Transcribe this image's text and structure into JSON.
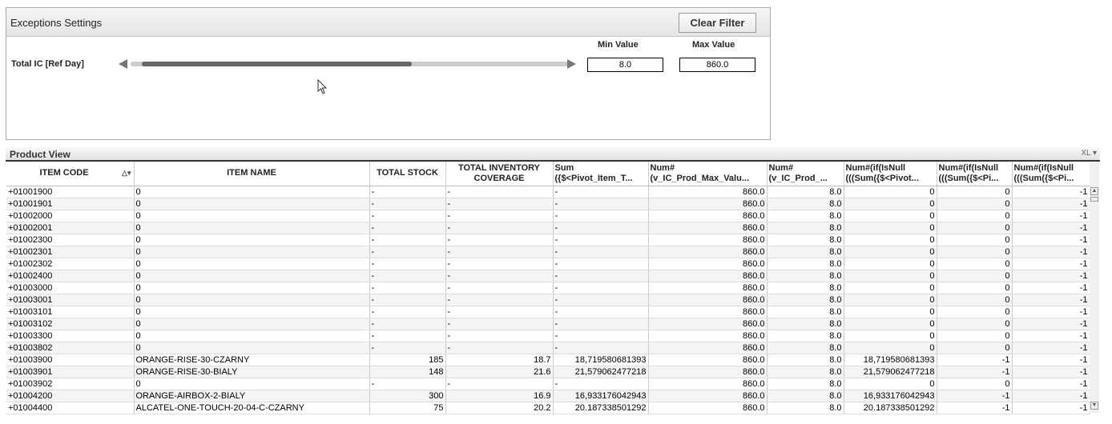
{
  "exceptions": {
    "title": "Exceptions Settings",
    "clear_filter": "Clear Filter",
    "field_label": "Total IC [Ref Day]",
    "min_label": "Min Value",
    "max_label": "Max Value",
    "min_value": "8.0",
    "max_value": "860.0",
    "slider": {
      "range_min": 0,
      "range_max": 1000,
      "low": 8,
      "high": 620
    }
  },
  "product_view": {
    "title": "Product View",
    "icons": "XL ▾",
    "columns": [
      "ITEM CODE",
      "ITEM NAME",
      "TOTAL STOCK",
      "TOTAL INVENTORY COVERAGE",
      "Sum ({$<Pivot_Item_T...",
      "Num# (v_IC_Prod_Max_Valu...",
      "Num# (v_IC_Prod_...",
      "Num#(if(IsNull (((Sum({$<Pivot...",
      "Num#(if(IsNull (((Sum({$<Pi...",
      "Num#(if(IsNull (((Sum({$<Pi..."
    ],
    "rows": [
      [
        "+01001900",
        "0",
        "-",
        "-",
        "-",
        "860.0",
        "8.0",
        "0",
        "0",
        "-1"
      ],
      [
        "+01001901",
        "0",
        "-",
        "-",
        "-",
        "860.0",
        "8.0",
        "0",
        "0",
        "-1"
      ],
      [
        "+01002000",
        "0",
        "-",
        "-",
        "-",
        "860.0",
        "8.0",
        "0",
        "0",
        "-1"
      ],
      [
        "+01002001",
        "0",
        "-",
        "-",
        "-",
        "860.0",
        "8.0",
        "0",
        "0",
        "-1"
      ],
      [
        "+01002300",
        "0",
        "-",
        "-",
        "-",
        "860.0",
        "8.0",
        "0",
        "0",
        "-1"
      ],
      [
        "+01002301",
        "0",
        "-",
        "-",
        "-",
        "860.0",
        "8.0",
        "0",
        "0",
        "-1"
      ],
      [
        "+01002302",
        "0",
        "-",
        "-",
        "-",
        "860.0",
        "8.0",
        "0",
        "0",
        "-1"
      ],
      [
        "+01002400",
        "0",
        "-",
        "-",
        "-",
        "860.0",
        "8.0",
        "0",
        "0",
        "-1"
      ],
      [
        "+01003000",
        "0",
        "-",
        "-",
        "-",
        "860.0",
        "8.0",
        "0",
        "0",
        "-1"
      ],
      [
        "+01003001",
        "0",
        "-",
        "-",
        "-",
        "860.0",
        "8.0",
        "0",
        "0",
        "-1"
      ],
      [
        "+01003101",
        "0",
        "-",
        "-",
        "-",
        "860.0",
        "8.0",
        "0",
        "0",
        "-1"
      ],
      [
        "+01003102",
        "0",
        "-",
        "-",
        "-",
        "860.0",
        "8.0",
        "0",
        "0",
        "-1"
      ],
      [
        "+01003300",
        "0",
        "-",
        "-",
        "-",
        "860.0",
        "8.0",
        "0",
        "0",
        "-1"
      ],
      [
        "+01003802",
        "0",
        "-",
        "-",
        "-",
        "860.0",
        "8.0",
        "0",
        "0",
        "-1"
      ],
      [
        "+01003900",
        "ORANGE-RISE-30-CZARNY",
        "185",
        "18.7",
        "18,719580681393",
        "860.0",
        "8.0",
        "18,719580681393",
        "-1",
        "-1"
      ],
      [
        "+01003901",
        "ORANGE-RISE-30-BIALY",
        "148",
        "21.6",
        "21,579062477218",
        "860.0",
        "8.0",
        "21,579062477218",
        "-1",
        "-1"
      ],
      [
        "+01003902",
        "0",
        "-",
        "-",
        "-",
        "860.0",
        "8.0",
        "0",
        "0",
        "-1"
      ],
      [
        "+01004200",
        "ORANGE-AIRBOX-2-BIALY",
        "300",
        "16.9",
        "16,933176042943",
        "860.0",
        "8.0",
        "16,933176042943",
        "-1",
        "-1"
      ],
      [
        "+01004400",
        "ALCATEL-ONE-TOUCH-20-04-C-CZARNY",
        "75",
        "20.2",
        "20.187338501292",
        "860.0",
        "8.0",
        "20.187338501292",
        "-1",
        "-1"
      ]
    ]
  }
}
